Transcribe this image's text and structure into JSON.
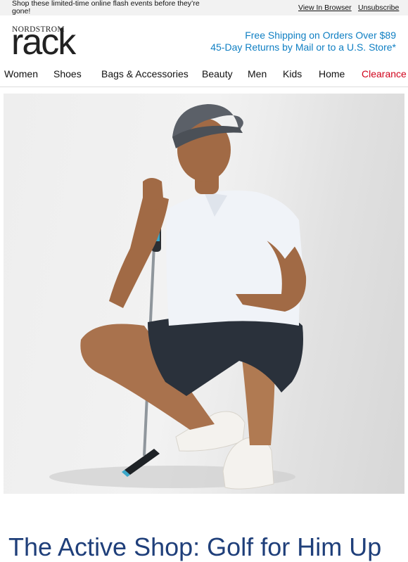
{
  "topbar": {
    "message": "Shop these limited-time online flash events before they’re gone!",
    "view_in_browser": "View In Browser",
    "unsubscribe": "Unsubscribe"
  },
  "logo": {
    "brand_top": "NORDSTROM",
    "brand_main": "rack"
  },
  "promo": {
    "line1": "Free Shipping on Orders Over $89",
    "line2": "45-Day Returns by Mail or to a U.S. Store*"
  },
  "nav": {
    "items": [
      "Women",
      "Shoes",
      "Bags & Accessories",
      "Beauty",
      "Men",
      "Kids",
      "Home",
      "Clearance"
    ]
  },
  "headline": "The Active Shop: Golf for Him Up",
  "colors": {
    "accent_blue": "#0f7fc3",
    "headline_navy": "#1f3f7a",
    "clearance_red": "#d0021b"
  }
}
